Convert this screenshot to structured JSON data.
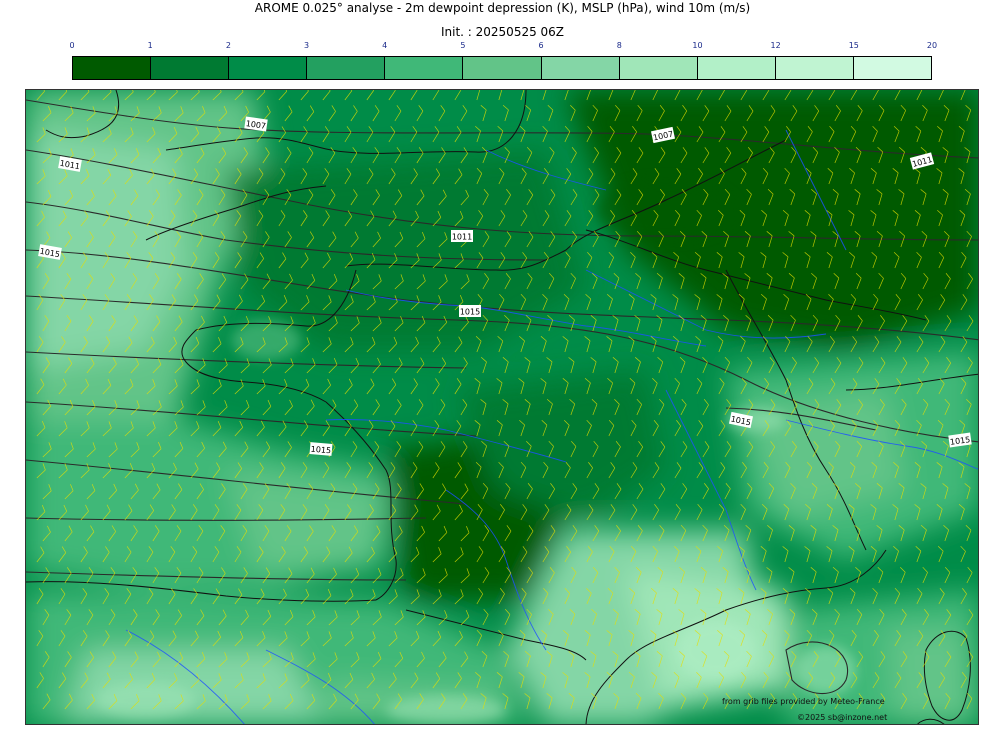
{
  "header": {
    "title": "AROME 0.025° analyse - 2m dewpoint depression (K), MSLP (hPa), wind 10m (m/s)",
    "init": "Init. : 20250525 06Z"
  },
  "colorbar": {
    "ticks": [
      "0",
      "1",
      "2",
      "3",
      "4",
      "5",
      "6",
      "8",
      "10",
      "12",
      "15",
      "20"
    ],
    "colors": [
      "#005a00",
      "#007a32",
      "#008c48",
      "#23a060",
      "#40b878",
      "#62c488",
      "#84d6a6",
      "#a0e6b8",
      "#b2f0c8",
      "#c0f4d2",
      "#d2fae2"
    ]
  },
  "map": {
    "isobar_labels": [
      "1007",
      "1007",
      "1011",
      "1011",
      "1011",
      "1015",
      "1015",
      "1015",
      "1015",
      "1015"
    ],
    "colors": {
      "isobar": "#2a2a2a",
      "coastline": "#111111",
      "river": "#1e50ff",
      "wind_barb": "#e6e000"
    }
  },
  "credits": {
    "source": "from grib files provided by Meteo-France",
    "copyright": "©2025 sb@inzone.net"
  }
}
